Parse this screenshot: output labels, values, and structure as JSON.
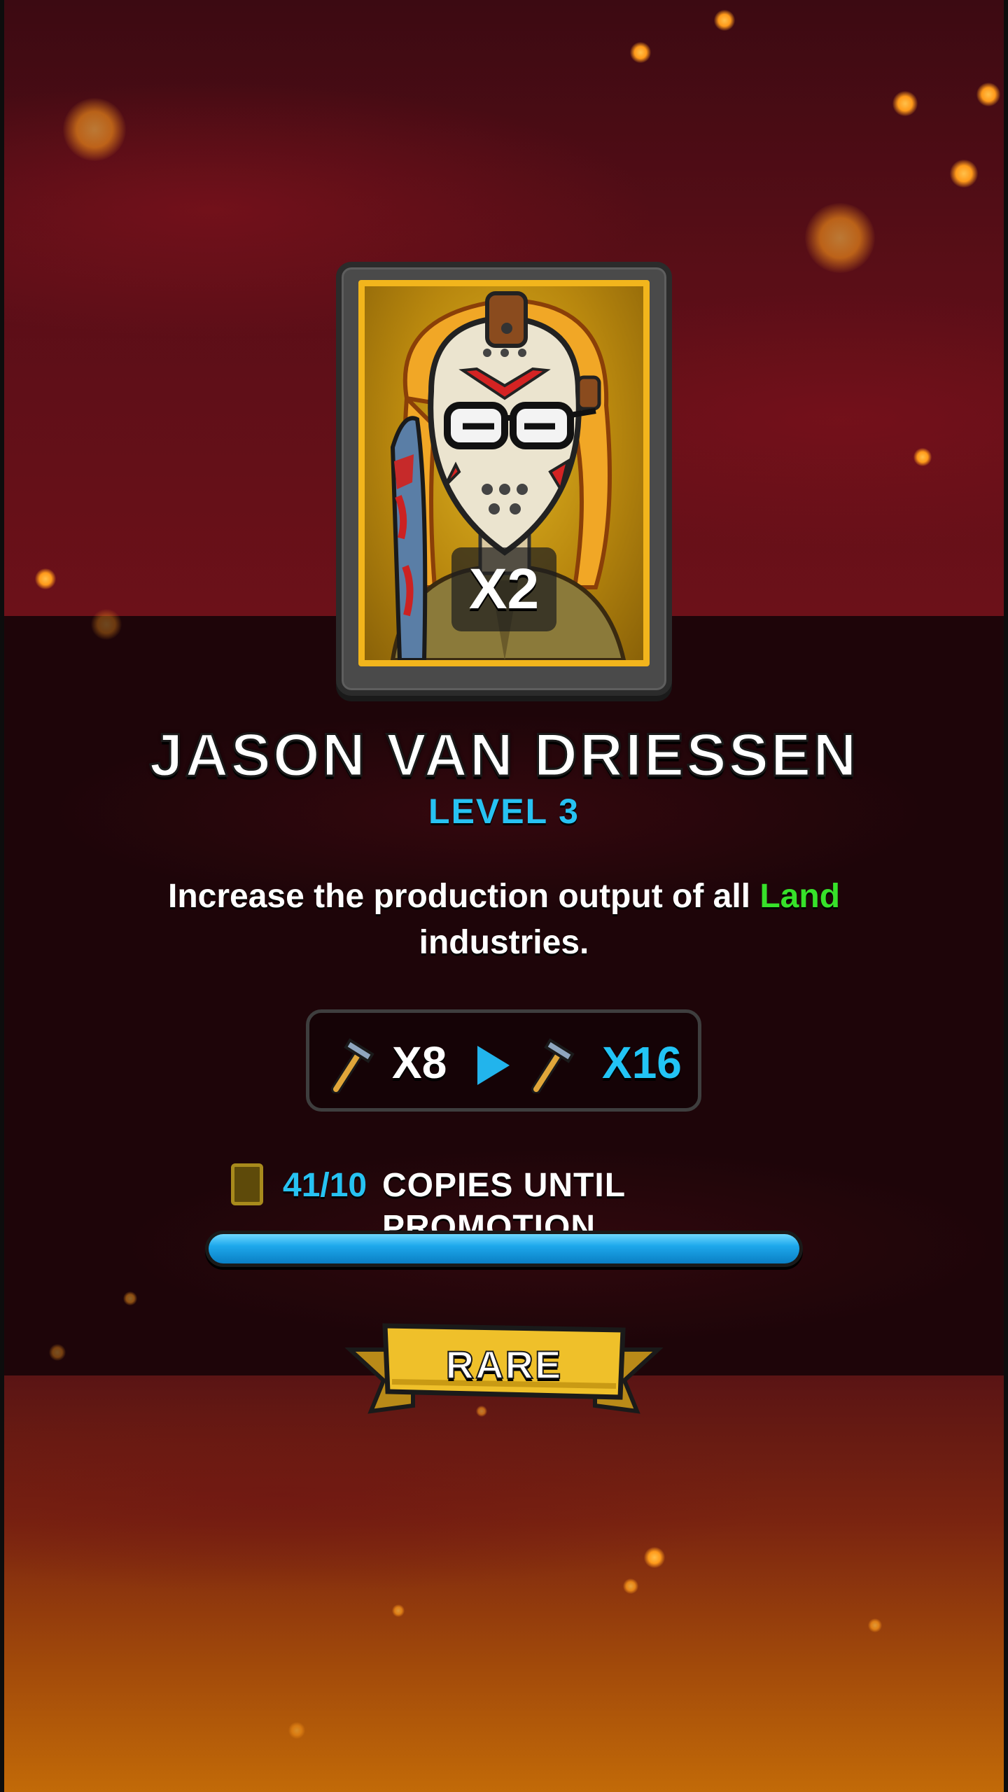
{
  "character": {
    "name": "JASON VAN DRIESSEN",
    "level_label": "LEVEL 3",
    "card_count": "X2",
    "portrait_icon": "masked-hockey-villain-portrait"
  },
  "ability": {
    "description_before": "Increase the production output of all ",
    "description_highlight": "Land",
    "description_after": " industries.",
    "highlight_color": "#37e12a"
  },
  "stat": {
    "icon": "hammer-icon",
    "from": "X8",
    "to": "X16",
    "arrow_icon": "play-arrow-icon"
  },
  "promotion": {
    "icon": "card-icon",
    "count": "41/10",
    "label": "COPIES UNTIL PROMOTION",
    "progress": 1.0
  },
  "rarity": {
    "label": "RARE",
    "ribbon_color": "#efc02a"
  },
  "colors": {
    "accent_blue": "#27c2f2",
    "card_gold": "#f2b51c"
  }
}
